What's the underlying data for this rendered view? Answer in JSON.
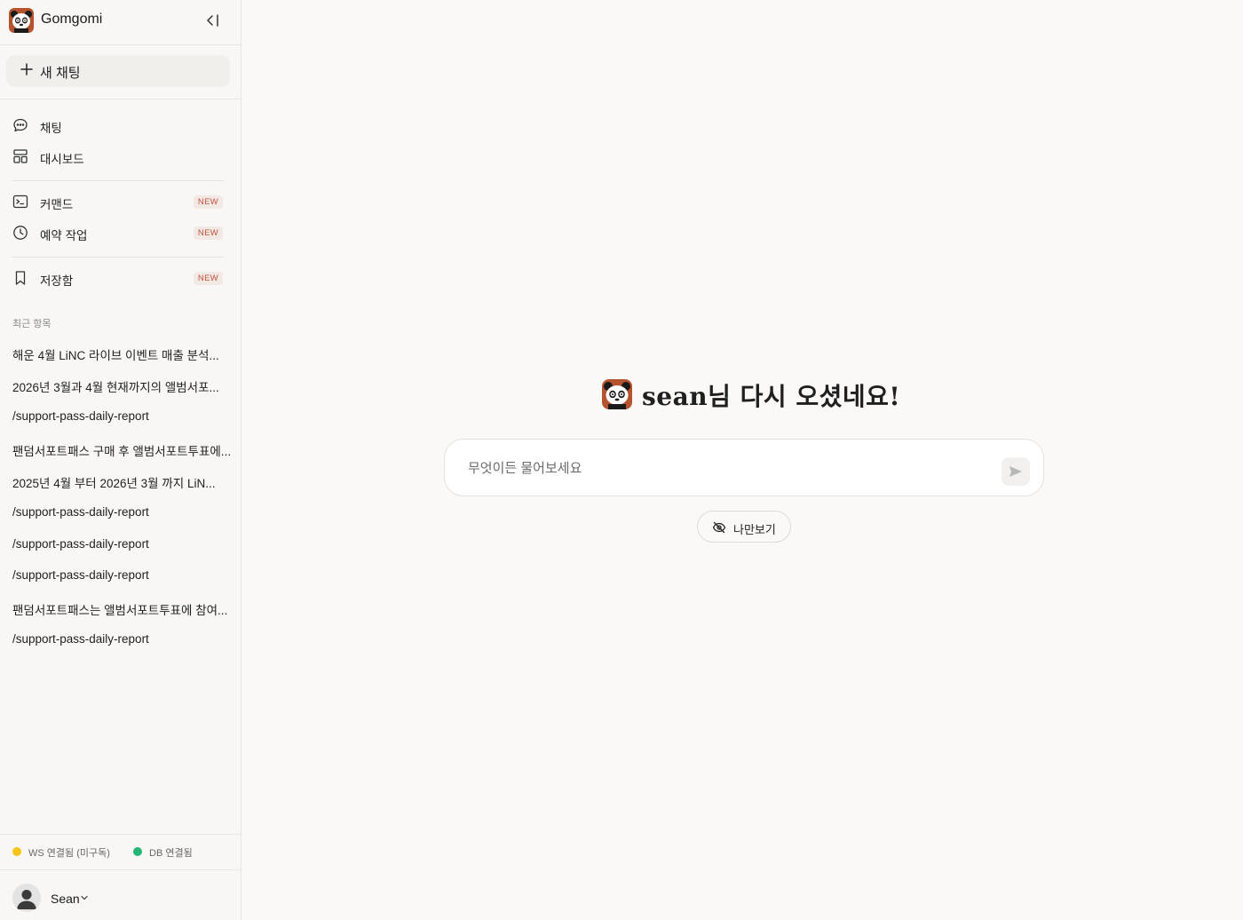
{
  "app": {
    "name": "Gomgomi"
  },
  "sidebar": {
    "new_chat_label": "새 채팅",
    "nav_main": [
      {
        "label": "채팅",
        "icon": "chat-bubble-icon"
      },
      {
        "label": "대시보드",
        "icon": "dashboard-icon"
      }
    ],
    "nav_tools": [
      {
        "label": "커맨드",
        "icon": "terminal-icon",
        "badge": "NEW"
      },
      {
        "label": "예약 작업",
        "icon": "clock-icon",
        "badge": "NEW"
      }
    ],
    "nav_saved": [
      {
        "label": "저장함",
        "icon": "bookmark-icon",
        "badge": "NEW"
      }
    ],
    "recent_label": "최근 항목",
    "recent_items": [
      "해운 4월 LiNC 라이브 이벤트 매출 분석...",
      "2026년 3월과 4월 현재까지의 앨범서포...",
      "/support-pass-daily-report",
      "팬덤서포트패스 구매 후 앨범서포트투표에...",
      "2025년 4월 부터 2026년 3월 까지 LiN...",
      "/support-pass-daily-report",
      "/support-pass-daily-report",
      "/support-pass-daily-report",
      "팬덤서포트패스는 앨범서포트투표에 참여...",
      "/support-pass-daily-report"
    ],
    "status": {
      "ws": {
        "label": "WS 연결됨 (미구독)",
        "color": "#f5c518"
      },
      "db": {
        "label": "DB 연결됨",
        "color": "#22b573"
      }
    },
    "user": {
      "name": "Sean"
    }
  },
  "main": {
    "greeting": "sean님 다시 오셨네요!",
    "prompt_placeholder": "무엇이든 물어보세요",
    "private_label": "나만보기"
  }
}
